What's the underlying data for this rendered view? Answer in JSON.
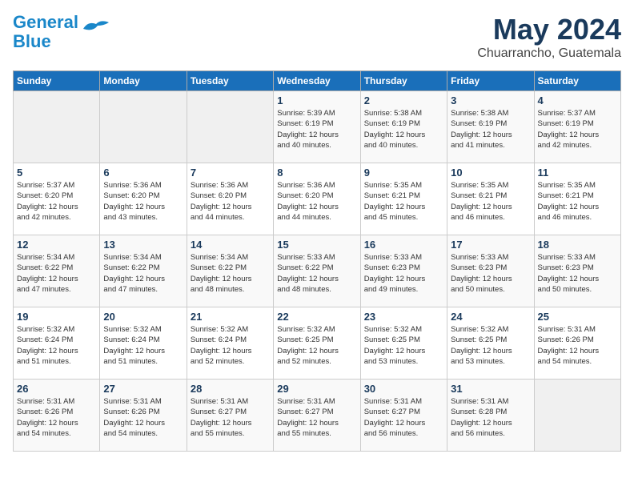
{
  "header": {
    "logo_line1": "General",
    "logo_line2": "Blue",
    "month_year": "May 2024",
    "location": "Chuarrancho, Guatemala"
  },
  "days_of_week": [
    "Sunday",
    "Monday",
    "Tuesday",
    "Wednesday",
    "Thursday",
    "Friday",
    "Saturday"
  ],
  "weeks": [
    [
      {
        "day": "",
        "info": ""
      },
      {
        "day": "",
        "info": ""
      },
      {
        "day": "",
        "info": ""
      },
      {
        "day": "1",
        "info": "Sunrise: 5:39 AM\nSunset: 6:19 PM\nDaylight: 12 hours\nand 40 minutes."
      },
      {
        "day": "2",
        "info": "Sunrise: 5:38 AM\nSunset: 6:19 PM\nDaylight: 12 hours\nand 40 minutes."
      },
      {
        "day": "3",
        "info": "Sunrise: 5:38 AM\nSunset: 6:19 PM\nDaylight: 12 hours\nand 41 minutes."
      },
      {
        "day": "4",
        "info": "Sunrise: 5:37 AM\nSunset: 6:19 PM\nDaylight: 12 hours\nand 42 minutes."
      }
    ],
    [
      {
        "day": "5",
        "info": "Sunrise: 5:37 AM\nSunset: 6:20 PM\nDaylight: 12 hours\nand 42 minutes."
      },
      {
        "day": "6",
        "info": "Sunrise: 5:36 AM\nSunset: 6:20 PM\nDaylight: 12 hours\nand 43 minutes."
      },
      {
        "day": "7",
        "info": "Sunrise: 5:36 AM\nSunset: 6:20 PM\nDaylight: 12 hours\nand 44 minutes."
      },
      {
        "day": "8",
        "info": "Sunrise: 5:36 AM\nSunset: 6:20 PM\nDaylight: 12 hours\nand 44 minutes."
      },
      {
        "day": "9",
        "info": "Sunrise: 5:35 AM\nSunset: 6:21 PM\nDaylight: 12 hours\nand 45 minutes."
      },
      {
        "day": "10",
        "info": "Sunrise: 5:35 AM\nSunset: 6:21 PM\nDaylight: 12 hours\nand 46 minutes."
      },
      {
        "day": "11",
        "info": "Sunrise: 5:35 AM\nSunset: 6:21 PM\nDaylight: 12 hours\nand 46 minutes."
      }
    ],
    [
      {
        "day": "12",
        "info": "Sunrise: 5:34 AM\nSunset: 6:22 PM\nDaylight: 12 hours\nand 47 minutes."
      },
      {
        "day": "13",
        "info": "Sunrise: 5:34 AM\nSunset: 6:22 PM\nDaylight: 12 hours\nand 47 minutes."
      },
      {
        "day": "14",
        "info": "Sunrise: 5:34 AM\nSunset: 6:22 PM\nDaylight: 12 hours\nand 48 minutes."
      },
      {
        "day": "15",
        "info": "Sunrise: 5:33 AM\nSunset: 6:22 PM\nDaylight: 12 hours\nand 48 minutes."
      },
      {
        "day": "16",
        "info": "Sunrise: 5:33 AM\nSunset: 6:23 PM\nDaylight: 12 hours\nand 49 minutes."
      },
      {
        "day": "17",
        "info": "Sunrise: 5:33 AM\nSunset: 6:23 PM\nDaylight: 12 hours\nand 50 minutes."
      },
      {
        "day": "18",
        "info": "Sunrise: 5:33 AM\nSunset: 6:23 PM\nDaylight: 12 hours\nand 50 minutes."
      }
    ],
    [
      {
        "day": "19",
        "info": "Sunrise: 5:32 AM\nSunset: 6:24 PM\nDaylight: 12 hours\nand 51 minutes."
      },
      {
        "day": "20",
        "info": "Sunrise: 5:32 AM\nSunset: 6:24 PM\nDaylight: 12 hours\nand 51 minutes."
      },
      {
        "day": "21",
        "info": "Sunrise: 5:32 AM\nSunset: 6:24 PM\nDaylight: 12 hours\nand 52 minutes."
      },
      {
        "day": "22",
        "info": "Sunrise: 5:32 AM\nSunset: 6:25 PM\nDaylight: 12 hours\nand 52 minutes."
      },
      {
        "day": "23",
        "info": "Sunrise: 5:32 AM\nSunset: 6:25 PM\nDaylight: 12 hours\nand 53 minutes."
      },
      {
        "day": "24",
        "info": "Sunrise: 5:32 AM\nSunset: 6:25 PM\nDaylight: 12 hours\nand 53 minutes."
      },
      {
        "day": "25",
        "info": "Sunrise: 5:31 AM\nSunset: 6:26 PM\nDaylight: 12 hours\nand 54 minutes."
      }
    ],
    [
      {
        "day": "26",
        "info": "Sunrise: 5:31 AM\nSunset: 6:26 PM\nDaylight: 12 hours\nand 54 minutes."
      },
      {
        "day": "27",
        "info": "Sunrise: 5:31 AM\nSunset: 6:26 PM\nDaylight: 12 hours\nand 54 minutes."
      },
      {
        "day": "28",
        "info": "Sunrise: 5:31 AM\nSunset: 6:27 PM\nDaylight: 12 hours\nand 55 minutes."
      },
      {
        "day": "29",
        "info": "Sunrise: 5:31 AM\nSunset: 6:27 PM\nDaylight: 12 hours\nand 55 minutes."
      },
      {
        "day": "30",
        "info": "Sunrise: 5:31 AM\nSunset: 6:27 PM\nDaylight: 12 hours\nand 56 minutes."
      },
      {
        "day": "31",
        "info": "Sunrise: 5:31 AM\nSunset: 6:28 PM\nDaylight: 12 hours\nand 56 minutes."
      },
      {
        "day": "",
        "info": ""
      }
    ]
  ]
}
